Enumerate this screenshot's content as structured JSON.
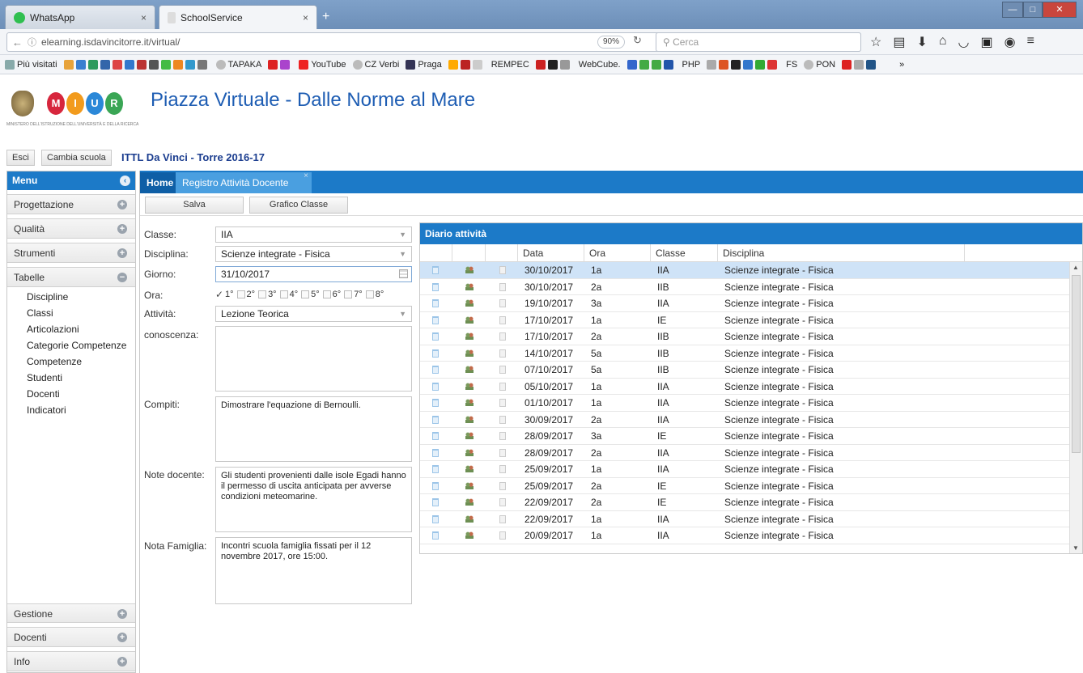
{
  "browser": {
    "tabs": [
      {
        "label": "WhatsApp",
        "icon": "whatsapp-icon"
      },
      {
        "label": "SchoolService",
        "icon": "page-icon"
      }
    ],
    "url": "elearning.isdavincitorre.it/virtual/",
    "zoom": "90%",
    "search_placeholder": "Cerca",
    "bookmarks": [
      "Più visitati",
      "TAPAKA",
      "YouTube",
      "CZ Verbi",
      "Praga",
      "REMPEC",
      "WebCube.",
      "PHP",
      "FS",
      "PON"
    ]
  },
  "header": {
    "title": "Piazza Virtuale - Dalle Norme al Mare",
    "logo_letters": [
      "M",
      "I",
      "U",
      "R"
    ],
    "logo_subtitle": "MINISTERO DELL'ISTRUZIONE DELL'UNIVERSITÀ E DELLA RICERCA",
    "esci": "Esci",
    "cambia_scuola": "Cambia scuola",
    "school": "ITTL Da Vinci - Torre 2016-17"
  },
  "menu": {
    "title": "Menu",
    "sections_top": [
      "Progettazione",
      "Qualità",
      "Strumenti"
    ],
    "tabelle": "Tabelle",
    "tabelle_items": [
      "Discipline",
      "Classi",
      "Articolazioni",
      "Categorie Competenze",
      "Competenze",
      "Studenti",
      "Docenti",
      "Indicatori"
    ],
    "sections_bottom": [
      "Gestione",
      "Docenti",
      "Info"
    ]
  },
  "content": {
    "tab_home": "Home",
    "tab_registro": "Registro Attività Docente",
    "btn_salva": "Salva",
    "btn_grafico": "Grafico Classe"
  },
  "form": {
    "classe_label": "Classe:",
    "classe_value": "IIA",
    "disciplina_label": "Disciplina:",
    "disciplina_value": "Scienze integrate - Fisica",
    "giorno_label": "Giorno:",
    "giorno_value": "31/10/2017",
    "ora_label": "Ora:",
    "ora_options": [
      "1°",
      "2°",
      "3°",
      "4°",
      "5°",
      "6°",
      "7°",
      "8°"
    ],
    "ora_checked": 0,
    "attivita_label": "Attività:",
    "attivita_value": "Lezione Teorica",
    "conoscenza_label": "conoscenza:",
    "conoscenza_value": "",
    "compiti_label": "Compiti:",
    "compiti_value": "Dimostrare l'equazione di Bernoulli.",
    "note_docente_label": "Note docente:",
    "note_docente_value": "Gli studenti provenienti dalle isole Egadi hanno il permesso di uscita anticipata per avverse condizioni meteomarine.",
    "nota_famiglia_label": "Nota Famiglia:",
    "nota_famiglia_value": "Incontri scuola famiglia fissati per il 12 novembre 2017, ore 15:00."
  },
  "diario": {
    "title": "Diario attività",
    "columns": [
      "Data",
      "Ora",
      "Classe",
      "Disciplina"
    ],
    "rows": [
      [
        "30/10/2017",
        "1a",
        "IIA",
        "Scienze integrate - Fisica"
      ],
      [
        "30/10/2017",
        "2a",
        "IIB",
        "Scienze integrate - Fisica"
      ],
      [
        "19/10/2017",
        "3a",
        "IIA",
        "Scienze integrate - Fisica"
      ],
      [
        "17/10/2017",
        "1a",
        "IE",
        "Scienze integrate - Fisica"
      ],
      [
        "17/10/2017",
        "2a",
        "IIB",
        "Scienze integrate - Fisica"
      ],
      [
        "14/10/2017",
        "5a",
        "IIB",
        "Scienze integrate - Fisica"
      ],
      [
        "07/10/2017",
        "5a",
        "IIB",
        "Scienze integrate - Fisica"
      ],
      [
        "05/10/2017",
        "1a",
        "IIA",
        "Scienze integrate - Fisica"
      ],
      [
        "01/10/2017",
        "1a",
        "IIA",
        "Scienze integrate - Fisica"
      ],
      [
        "30/09/2017",
        "2a",
        "IIA",
        "Scienze integrate - Fisica"
      ],
      [
        "28/09/2017",
        "3a",
        "IE",
        "Scienze integrate - Fisica"
      ],
      [
        "28/09/2017",
        "2a",
        "IIA",
        "Scienze integrate - Fisica"
      ],
      [
        "25/09/2017",
        "1a",
        "IIA",
        "Scienze integrate - Fisica"
      ],
      [
        "25/09/2017",
        "2a",
        "IE",
        "Scienze integrate - Fisica"
      ],
      [
        "22/09/2017",
        "2a",
        "IE",
        "Scienze integrate - Fisica"
      ],
      [
        "22/09/2017",
        "1a",
        "IIA",
        "Scienze integrate - Fisica"
      ],
      [
        "20/09/2017",
        "1a",
        "IIA",
        "Scienze integrate - Fisica"
      ]
    ],
    "selected_row": 0
  },
  "colors": {
    "accent": "#1c7ac8",
    "title": "#1e5db3",
    "school": "#1b3d8f"
  }
}
